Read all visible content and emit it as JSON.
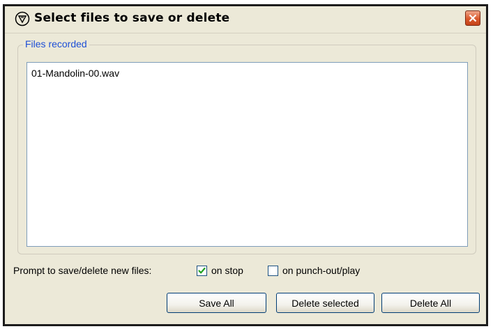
{
  "dialog": {
    "title": "Select files to save or delete"
  },
  "files_group": {
    "label": "Files recorded",
    "files": [
      "01-Mandolin-00.wav"
    ]
  },
  "prompt": {
    "label": "Prompt to save/delete new files:",
    "on_stop": {
      "label": "on stop",
      "checked": true
    },
    "on_punch_out": {
      "label": "on punch-out/play",
      "checked": false
    }
  },
  "buttons": {
    "save_all": "Save All",
    "delete_selected": "Delete selected",
    "delete_all": "Delete All"
  },
  "colors": {
    "group_label": "#1e4fd6",
    "checkmark": "#21a121",
    "close_button": "#d9582c"
  }
}
